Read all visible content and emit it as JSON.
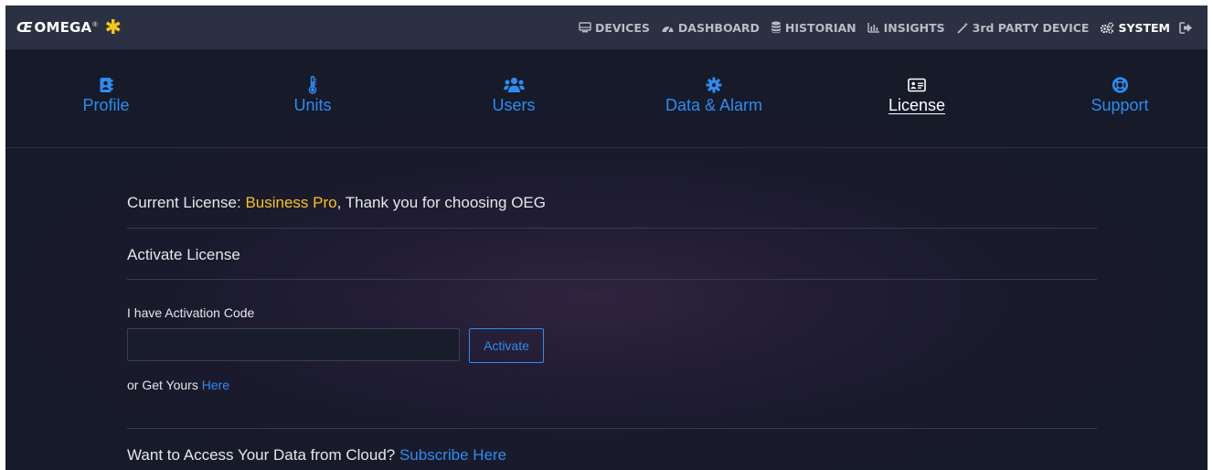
{
  "brand": {
    "logo_mark": "Œ",
    "logo_text": "OMEGA",
    "logo_tm": "®",
    "star": "✱",
    "accent": "#f5c518"
  },
  "topnav": {
    "items": [
      {
        "label": "DEVICES",
        "icon": "monitor-icon"
      },
      {
        "label": "DASHBOARD",
        "icon": "gauge-icon"
      },
      {
        "label": "HISTORIAN",
        "icon": "database-icon"
      },
      {
        "label": "INSIGHTS",
        "icon": "bar-chart-icon"
      },
      {
        "label": "3rd PARTY DEVICE",
        "icon": "magic-wand-icon"
      },
      {
        "label": "SYSTEM",
        "icon": "cogs-icon",
        "active": true
      }
    ],
    "logout_icon": "sign-out-icon"
  },
  "subnav": {
    "items": [
      {
        "label": "Profile",
        "icon": "address-book-icon"
      },
      {
        "label": "Units",
        "icon": "thermometer-icon"
      },
      {
        "label": "Users",
        "icon": "users-icon"
      },
      {
        "label": "Data & Alarm",
        "icon": "gear-icon"
      },
      {
        "label": "License",
        "icon": "id-card-icon",
        "active": true
      },
      {
        "label": "Support",
        "icon": "life-ring-icon"
      }
    ]
  },
  "license": {
    "current_prefix": "Current License: ",
    "plan": "Business Pro",
    "current_suffix": ", Thank you for choosing OEG",
    "activate_heading": "Activate License",
    "code_label": "I have Activation Code",
    "code_value": "",
    "code_placeholder": "",
    "activate_button": "Activate",
    "get_yours_prefix": "or Get Yours ",
    "get_yours_link": "Here",
    "cloud_prefix": "Want to Access Your Data from Cloud? ",
    "cloud_link": "Subscribe Here"
  },
  "colors": {
    "link": "#2d8cf0",
    "background": "#1a1a2c",
    "topbar": "#2b3142"
  }
}
